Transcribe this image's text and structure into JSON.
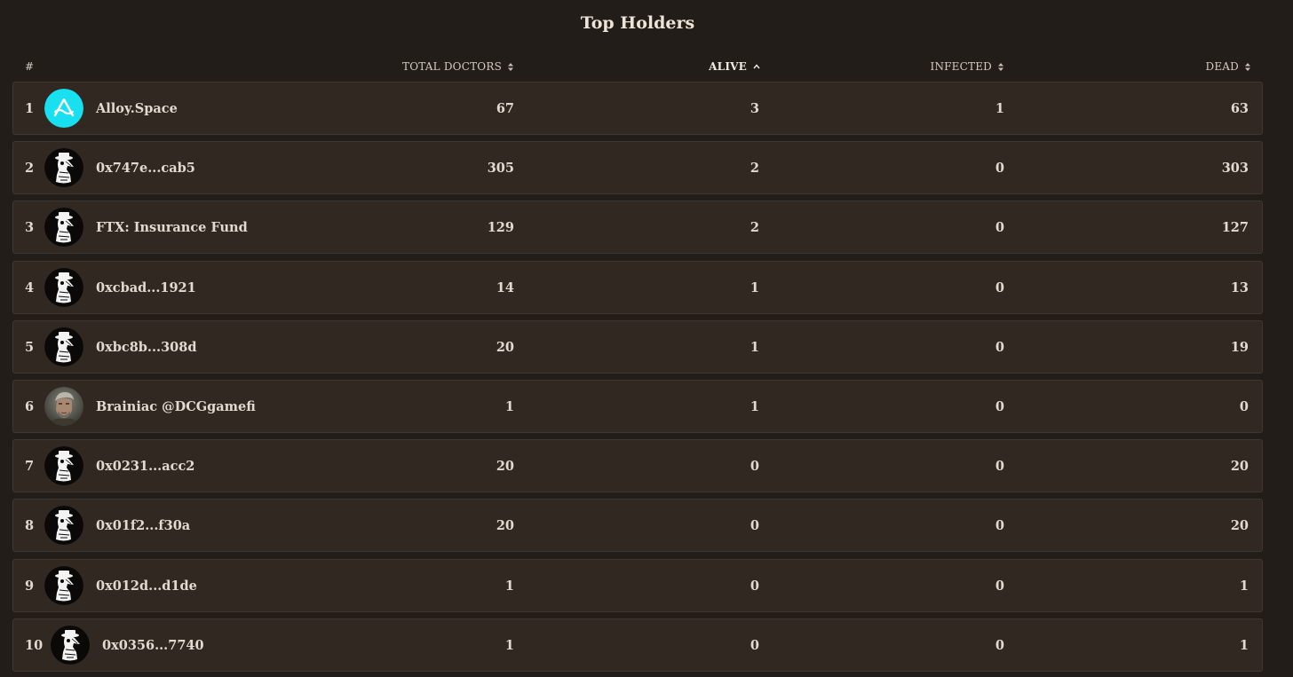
{
  "page": {
    "title": "Top Holders"
  },
  "table": {
    "columns": {
      "num": "#",
      "total": "TOTAL DOCTORS",
      "alive": "ALIVE",
      "infected": "INFECTED",
      "dead": "DEAD"
    },
    "sorted_column": "alive",
    "sort_direction": "ascending",
    "rows": [
      {
        "num": "1",
        "name": "Alloy.Space",
        "avatar": "alloy-logo-icon",
        "total": "67",
        "alive": "3",
        "infected": "1",
        "dead": "63"
      },
      {
        "num": "2",
        "name": "0x747e...cab5",
        "avatar": "plague-doctor-icon",
        "total": "305",
        "alive": "2",
        "infected": "0",
        "dead": "303"
      },
      {
        "num": "3",
        "name": "FTX: Insurance Fund",
        "avatar": "plague-doctor-icon",
        "total": "129",
        "alive": "2",
        "infected": "0",
        "dead": "127"
      },
      {
        "num": "4",
        "name": "0xcbad...1921",
        "avatar": "plague-doctor-icon",
        "total": "14",
        "alive": "1",
        "infected": "0",
        "dead": "13"
      },
      {
        "num": "5",
        "name": "0xbc8b...308d",
        "avatar": "plague-doctor-icon",
        "total": "20",
        "alive": "1",
        "infected": "0",
        "dead": "19"
      },
      {
        "num": "6",
        "name": "Brainiac @DCGgamefi",
        "avatar": "user-portrait-avatar",
        "total": "1",
        "alive": "1",
        "infected": "0",
        "dead": "0"
      },
      {
        "num": "7",
        "name": "0x0231...acc2",
        "avatar": "plague-doctor-icon",
        "total": "20",
        "alive": "0",
        "infected": "0",
        "dead": "20"
      },
      {
        "num": "8",
        "name": "0x01f2...f30a",
        "avatar": "plague-doctor-icon",
        "total": "20",
        "alive": "0",
        "infected": "0",
        "dead": "20"
      },
      {
        "num": "9",
        "name": "0x012d...d1de",
        "avatar": "plague-doctor-icon",
        "total": "1",
        "alive": "0",
        "infected": "0",
        "dead": "1"
      },
      {
        "num": "10",
        "name": "0x0356...7740",
        "avatar": "plague-doctor-icon",
        "total": "1",
        "alive": "0",
        "infected": "0",
        "dead": "1"
      }
    ]
  },
  "colors": {
    "background": "#221d19",
    "row_background": "#312822",
    "row_border": "#3f3630",
    "text": "#e3dacf",
    "alloy_accent": "#19e0f0"
  }
}
